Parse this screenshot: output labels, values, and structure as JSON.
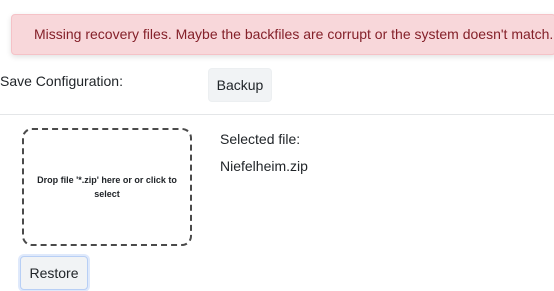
{
  "alert": {
    "message": "Missing recovery files. Maybe the backfiles are corrupt or the system doesn't match."
  },
  "save": {
    "label": "Save Configuration:",
    "backup_button": "Backup"
  },
  "restore": {
    "dropzone_text": "Drop file '*.zip' here or or click to select",
    "selected_label": "Selected file:",
    "selected_value": "Niefelheim.zip",
    "restore_button": "Restore"
  }
}
